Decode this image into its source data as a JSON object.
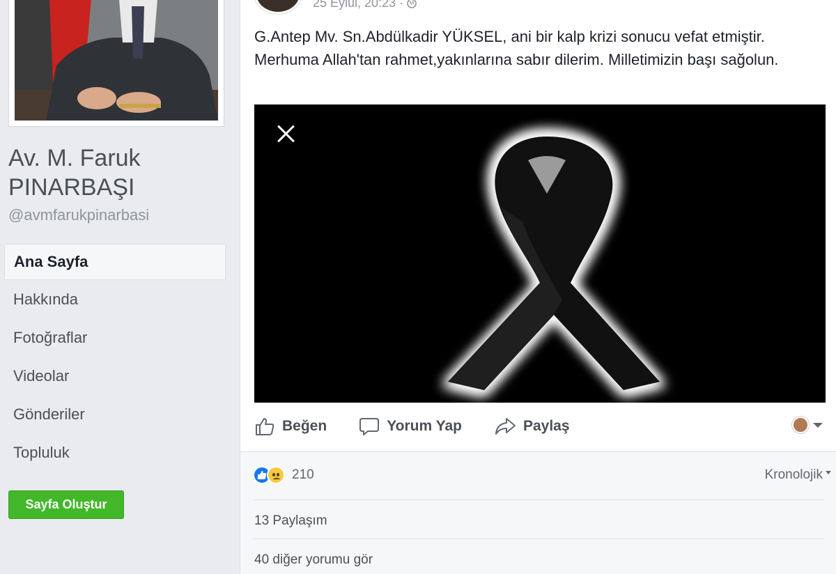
{
  "page": {
    "name": "Av. M. Faruk PINARBAŞI",
    "handle": "@avmfarukpinarbasi"
  },
  "nav": {
    "items": [
      {
        "label": "Ana Sayfa"
      },
      {
        "label": "Hakkında"
      },
      {
        "label": "Fotoğraflar"
      },
      {
        "label": "Videolar"
      },
      {
        "label": "Gönderiler"
      },
      {
        "label": "Topluluk"
      }
    ],
    "create_page": "Sayfa Oluştur"
  },
  "post": {
    "timestamp": "25 Eylül, 20:23 · ",
    "text": "G.Antep Mv. Sn.Abdülkadir YÜKSEL, ani bir kalp krizi sonucu vefat etmiştir. Merhuma Allah'tan rahmet,yakınlarına sabır dilerim. Milletimizin başı sağolun.",
    "actions": {
      "like": "Beğen",
      "comment": "Yorum Yap",
      "share": "Paylaş"
    }
  },
  "feedback": {
    "reaction_count": "210",
    "sort_label": "Kronolojik",
    "shares": "13 Paylaşım",
    "more_comments": "40 diğer yorumu gör"
  },
  "colors": {
    "like_blue": "#1877f2",
    "create_green": "#42b72a",
    "background": "#e9ebee"
  }
}
